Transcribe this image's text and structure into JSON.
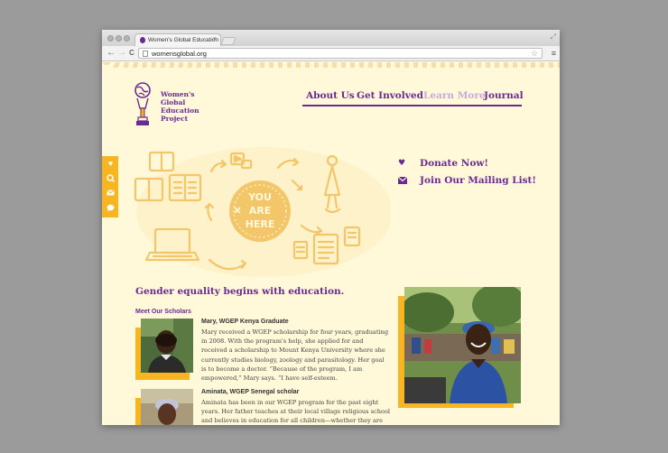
{
  "browser": {
    "tab_title": "Women's Global Education",
    "tab_close": "×",
    "url": "womensglobal.org",
    "back": "←",
    "forward": "→",
    "reload": "C",
    "star": "☆",
    "menu": "≡",
    "resize": "⤢"
  },
  "logo": {
    "text": "Women's Global Education Project",
    "line1": "Women's",
    "line2": "Global",
    "line3": "Education",
    "line4": "Project"
  },
  "nav": {
    "items": [
      {
        "label": "About Us",
        "state": "normal"
      },
      {
        "label": "Get Involved",
        "state": "normal"
      },
      {
        "label": "Learn More",
        "state": "dimmed"
      },
      {
        "label": "Journal",
        "state": "normal"
      }
    ]
  },
  "hero": {
    "stamp_line1": "YOU",
    "stamp_line2": "ARE",
    "stamp_line3": "HERE"
  },
  "side_tab": {
    "icons": [
      "heart-icon",
      "search-icon",
      "mail-icon",
      "chat-icon"
    ]
  },
  "cta": {
    "donate": {
      "label": "Donate Now!",
      "icon": "heart-icon"
    },
    "mailing": {
      "label": "Join Our Mailing List!",
      "icon": "mail-icon"
    }
  },
  "main": {
    "tagline": "Gender equality begins with education.",
    "meet_heading": "Meet Our Scholars",
    "scholars": [
      {
        "name": "Mary, WGEP Kenya Graduate",
        "bio": "Mary received a WGEP scholarship for four years, graduating in 2008. With the program's help, she applied for and received a scholarship to Mount Kenya University where she currently studies biology, zoology and parasitology. Her goal is to become a doctor. “Because of the program, I am empowered,” Mary says. “I have self-esteem."
      },
      {
        "name": "Aminata, WGEP Senegal scholar",
        "bio": "Aminata has been in our WGEP program for the past eight years. Her father teaches at their local village religious school and believes in education for all children—whether they are"
      }
    ]
  },
  "colors": {
    "brand_purple": "#6b2a93",
    "accent_yellow": "#f7b521",
    "page_bg": "#fff8d9"
  }
}
